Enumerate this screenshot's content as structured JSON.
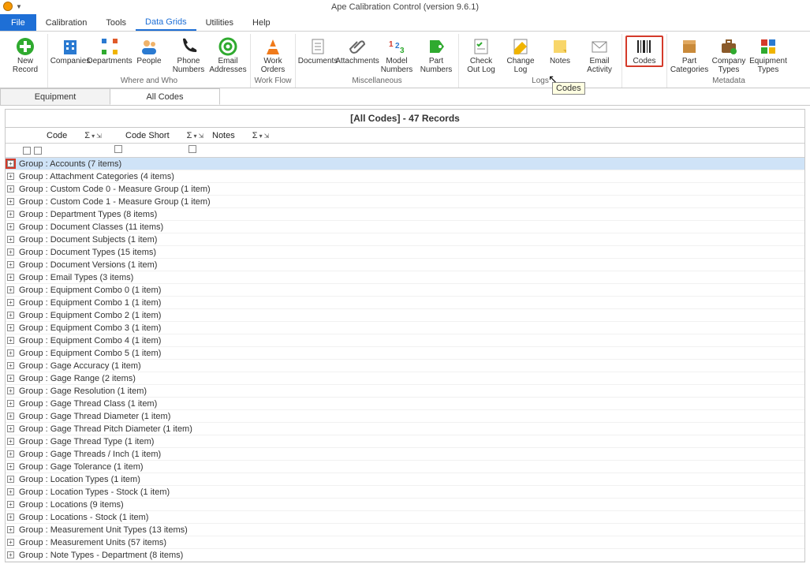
{
  "app": {
    "title": "Ape Calibration Control (version 9.6.1)"
  },
  "menu": {
    "file": "File",
    "items": [
      "Calibration",
      "Tools",
      "Data Grids",
      "Utilities",
      "Help"
    ],
    "active_index": 2
  },
  "ribbon": {
    "groups": [
      {
        "caption": "",
        "items": [
          {
            "name": "new-record",
            "label": "New\nRecord",
            "icon": "plus"
          }
        ]
      },
      {
        "caption": "Where and Who",
        "items": [
          {
            "name": "companies",
            "label": "Companies",
            "icon": "building"
          },
          {
            "name": "departments",
            "label": "Departments",
            "icon": "dept"
          },
          {
            "name": "people",
            "label": "People",
            "icon": "people"
          },
          {
            "name": "phone-numbers",
            "label": "Phone\nNumbers",
            "icon": "phone"
          },
          {
            "name": "email-addresses",
            "label": "Email\nAddresses",
            "icon": "at"
          }
        ]
      },
      {
        "caption": "Work Flow",
        "items": [
          {
            "name": "work-orders",
            "label": "Work\nOrders",
            "icon": "cone"
          }
        ]
      },
      {
        "caption": "Miscellaneous",
        "items": [
          {
            "name": "documents",
            "label": "Documents",
            "icon": "doc"
          },
          {
            "name": "attachments",
            "label": "Attachments",
            "icon": "clip"
          },
          {
            "name": "model-numbers",
            "label": "Model\nNumbers",
            "icon": "numbers"
          },
          {
            "name": "part-numbers",
            "label": "Part\nNumbers",
            "icon": "tag"
          }
        ]
      },
      {
        "caption": "Logs",
        "items": [
          {
            "name": "check-out-log",
            "label": "Check\nOut Log",
            "icon": "checklist"
          },
          {
            "name": "change-log",
            "label": "Change\nLog",
            "icon": "edit"
          },
          {
            "name": "notes",
            "label": "Notes",
            "icon": "note"
          },
          {
            "name": "email-activity",
            "label": "Email\nActivity",
            "icon": "mail"
          }
        ]
      },
      {
        "caption": "",
        "items": [
          {
            "name": "codes",
            "label": "Codes",
            "icon": "barcode",
            "highlight": true
          }
        ]
      },
      {
        "caption": "Metadata",
        "items": [
          {
            "name": "part-categories",
            "label": "Part\nCategories",
            "icon": "box"
          },
          {
            "name": "company-types",
            "label": "Company\nTypes",
            "icon": "briefcase"
          },
          {
            "name": "equipment-types",
            "label": "Equipment\nTypes",
            "icon": "grid"
          }
        ]
      }
    ]
  },
  "tooltip": "Codes",
  "subtabs": {
    "tabs": [
      "Equipment",
      "All Codes"
    ],
    "active_index": 1
  },
  "panel": {
    "title": "[All Codes] - 47 Records",
    "columns": [
      "Code",
      "Code Short",
      "Notes"
    ],
    "sigma": "Σ"
  },
  "grid": {
    "rows": [
      {
        "label": "Group : Accounts (7 items)",
        "selected": true
      },
      {
        "label": "Group : Attachment Categories (4 items)"
      },
      {
        "label": "Group : Custom Code 0 - Measure Group (1 item)"
      },
      {
        "label": "Group : Custom Code 1 - Measure Group (1 item)"
      },
      {
        "label": "Group : Department Types (8 items)"
      },
      {
        "label": "Group : Document Classes (11 items)"
      },
      {
        "label": "Group : Document Subjects (1 item)"
      },
      {
        "label": "Group : Document Types (15 items)"
      },
      {
        "label": "Group : Document Versions (1 item)"
      },
      {
        "label": "Group : Email Types (3 items)"
      },
      {
        "label": "Group : Equipment Combo 0 (1 item)"
      },
      {
        "label": "Group : Equipment Combo 1 (1 item)"
      },
      {
        "label": "Group : Equipment Combo 2 (1 item)"
      },
      {
        "label": "Group : Equipment Combo 3 (1 item)"
      },
      {
        "label": "Group : Equipment Combo 4 (1 item)"
      },
      {
        "label": "Group : Equipment Combo 5 (1 item)"
      },
      {
        "label": "Group : Gage Accuracy (1 item)"
      },
      {
        "label": "Group : Gage Range (2 items)"
      },
      {
        "label": "Group : Gage Resolution (1 item)"
      },
      {
        "label": "Group : Gage Thread Class (1 item)"
      },
      {
        "label": "Group : Gage Thread Diameter (1 item)"
      },
      {
        "label": "Group : Gage Thread Pitch Diameter (1 item)"
      },
      {
        "label": "Group : Gage Thread Type (1 item)"
      },
      {
        "label": "Group : Gage Threads / Inch (1 item)"
      },
      {
        "label": "Group : Gage Tolerance (1 item)"
      },
      {
        "label": "Group : Location Types (1 item)"
      },
      {
        "label": "Group : Location Types - Stock (1 item)"
      },
      {
        "label": "Group : Locations (9 items)"
      },
      {
        "label": "Group : Locations - Stock (1 item)"
      },
      {
        "label": "Group : Measurement Unit Types (13 items)"
      },
      {
        "label": "Group : Measurement Units (57 items)"
      },
      {
        "label": "Group : Note Types - Department (8 items)"
      }
    ]
  }
}
